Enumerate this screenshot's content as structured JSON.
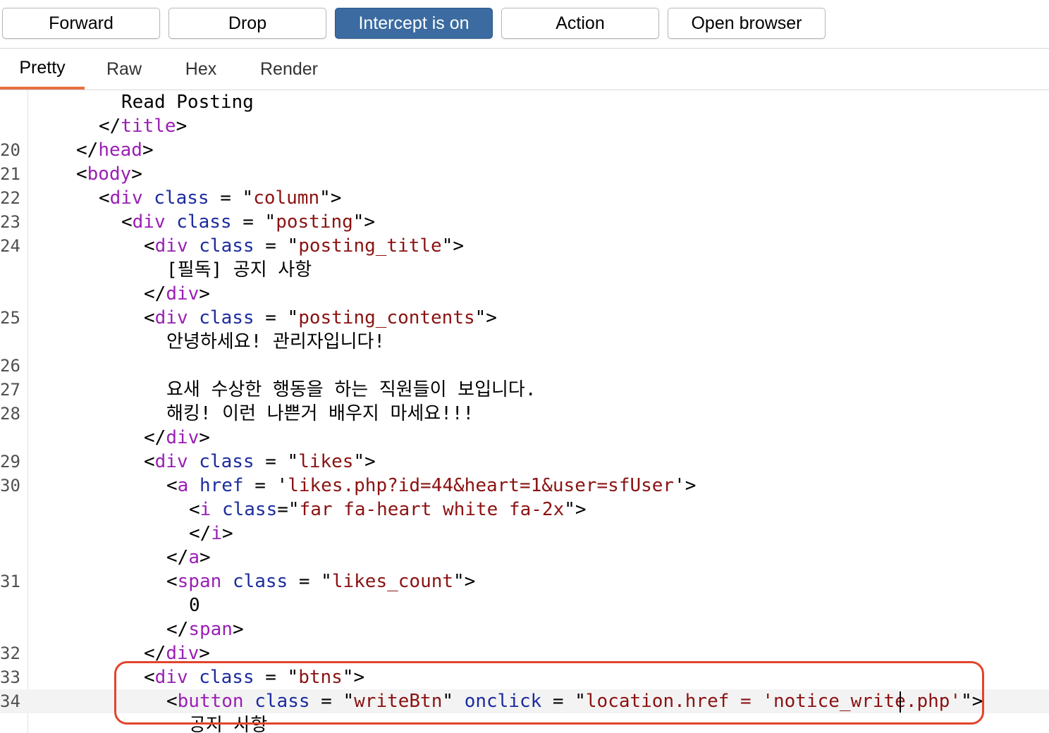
{
  "toolbar": {
    "forward_label": "Forward",
    "drop_label": "Drop",
    "intercept_label": "Intercept is on",
    "action_label": "Action",
    "open_browser_label": "Open browser"
  },
  "tabs": {
    "pretty": "Pretty",
    "raw": "Raw",
    "hex": "Hex",
    "render": "Render",
    "selected": "Pretty"
  },
  "colors": {
    "tag": "#9a1fb5",
    "attribute": "#1b2c9e",
    "string": "#8b1212",
    "accent_tab": "#e8703f",
    "intercept_button": "#3b6ba0",
    "highlight_box": "#e2442b"
  },
  "code": {
    "current_line": "34",
    "lines": [
      {
        "num": "",
        "indent": 4,
        "tokens": [
          {
            "t": "p",
            "s": "Read Posting"
          }
        ]
      },
      {
        "num": "",
        "indent": 3,
        "tokens": [
          {
            "t": "p",
            "s": "</"
          },
          {
            "t": "tag",
            "s": "title"
          },
          {
            "t": "p",
            "s": ">"
          }
        ]
      },
      {
        "num": "20",
        "indent": 2,
        "tokens": [
          {
            "t": "p",
            "s": "</"
          },
          {
            "t": "tag",
            "s": "head"
          },
          {
            "t": "p",
            "s": ">"
          }
        ]
      },
      {
        "num": "21",
        "indent": 2,
        "tokens": [
          {
            "t": "p",
            "s": "<"
          },
          {
            "t": "tag",
            "s": "body"
          },
          {
            "t": "p",
            "s": ">"
          }
        ]
      },
      {
        "num": "22",
        "indent": 3,
        "tokens": [
          {
            "t": "p",
            "s": "<"
          },
          {
            "t": "tag",
            "s": "div"
          },
          {
            "t": "p",
            "s": " "
          },
          {
            "t": "attr",
            "s": "class"
          },
          {
            "t": "p",
            "s": " = \""
          },
          {
            "t": "str",
            "s": "column"
          },
          {
            "t": "p",
            "s": "\">"
          }
        ]
      },
      {
        "num": "23",
        "indent": 4,
        "tokens": [
          {
            "t": "p",
            "s": "<"
          },
          {
            "t": "tag",
            "s": "div"
          },
          {
            "t": "p",
            "s": " "
          },
          {
            "t": "attr",
            "s": "class"
          },
          {
            "t": "p",
            "s": " = \""
          },
          {
            "t": "str",
            "s": "posting"
          },
          {
            "t": "p",
            "s": "\">"
          }
        ]
      },
      {
        "num": "24",
        "indent": 5,
        "tokens": [
          {
            "t": "p",
            "s": "<"
          },
          {
            "t": "tag",
            "s": "div"
          },
          {
            "t": "p",
            "s": " "
          },
          {
            "t": "attr",
            "s": "class"
          },
          {
            "t": "p",
            "s": " = \""
          },
          {
            "t": "str",
            "s": "posting_title"
          },
          {
            "t": "p",
            "s": "\">"
          }
        ]
      },
      {
        "num": "",
        "indent": 6,
        "tokens": [
          {
            "t": "p",
            "s": "[필독] 공지 사항"
          }
        ]
      },
      {
        "num": "",
        "indent": 5,
        "tokens": [
          {
            "t": "p",
            "s": "</"
          },
          {
            "t": "tag",
            "s": "div"
          },
          {
            "t": "p",
            "s": ">"
          }
        ]
      },
      {
        "num": "25",
        "indent": 5,
        "tokens": [
          {
            "t": "p",
            "s": "<"
          },
          {
            "t": "tag",
            "s": "div"
          },
          {
            "t": "p",
            "s": " "
          },
          {
            "t": "attr",
            "s": "class"
          },
          {
            "t": "p",
            "s": " = \""
          },
          {
            "t": "str",
            "s": "posting_contents"
          },
          {
            "t": "p",
            "s": "\">"
          }
        ]
      },
      {
        "num": "",
        "indent": 6,
        "tokens": [
          {
            "t": "p",
            "s": "안녕하세요! 관리자입니다!"
          }
        ]
      },
      {
        "num": "26",
        "indent": 6,
        "tokens": []
      },
      {
        "num": "27",
        "indent": 6,
        "tokens": [
          {
            "t": "p",
            "s": "요새 수상한 행동을 하는 직원들이 보입니다."
          }
        ]
      },
      {
        "num": "28",
        "indent": 6,
        "tokens": [
          {
            "t": "p",
            "s": "해킹! 이런 나쁜거 배우지 마세요!!!"
          }
        ]
      },
      {
        "num": "",
        "indent": 5,
        "tokens": [
          {
            "t": "p",
            "s": "</"
          },
          {
            "t": "tag",
            "s": "div"
          },
          {
            "t": "p",
            "s": ">"
          }
        ]
      },
      {
        "num": "29",
        "indent": 5,
        "tokens": [
          {
            "t": "p",
            "s": "<"
          },
          {
            "t": "tag",
            "s": "div"
          },
          {
            "t": "p",
            "s": " "
          },
          {
            "t": "attr",
            "s": "class"
          },
          {
            "t": "p",
            "s": " = \""
          },
          {
            "t": "str",
            "s": "likes"
          },
          {
            "t": "p",
            "s": "\">"
          }
        ]
      },
      {
        "num": "30",
        "indent": 6,
        "tokens": [
          {
            "t": "p",
            "s": "<"
          },
          {
            "t": "tag",
            "s": "a"
          },
          {
            "t": "p",
            "s": " "
          },
          {
            "t": "attr",
            "s": "href"
          },
          {
            "t": "p",
            "s": " = '"
          },
          {
            "t": "str",
            "s": "likes.php?id=44&heart=1&user=sfUser"
          },
          {
            "t": "p",
            "s": "'>"
          }
        ]
      },
      {
        "num": "",
        "indent": 7,
        "tokens": [
          {
            "t": "p",
            "s": "<"
          },
          {
            "t": "tag",
            "s": "i"
          },
          {
            "t": "p",
            "s": " "
          },
          {
            "t": "attr",
            "s": "class"
          },
          {
            "t": "p",
            "s": "=\""
          },
          {
            "t": "str",
            "s": "far fa-heart white fa-2x"
          },
          {
            "t": "p",
            "s": "\">"
          }
        ]
      },
      {
        "num": "",
        "indent": 7,
        "tokens": [
          {
            "t": "p",
            "s": "</"
          },
          {
            "t": "tag",
            "s": "i"
          },
          {
            "t": "p",
            "s": ">"
          }
        ]
      },
      {
        "num": "",
        "indent": 6,
        "tokens": [
          {
            "t": "p",
            "s": "</"
          },
          {
            "t": "tag",
            "s": "a"
          },
          {
            "t": "p",
            "s": ">"
          }
        ]
      },
      {
        "num": "31",
        "indent": 6,
        "tokens": [
          {
            "t": "p",
            "s": "<"
          },
          {
            "t": "tag",
            "s": "span"
          },
          {
            "t": "p",
            "s": " "
          },
          {
            "t": "attr",
            "s": "class"
          },
          {
            "t": "p",
            "s": " = \""
          },
          {
            "t": "str",
            "s": "likes_count"
          },
          {
            "t": "p",
            "s": "\">"
          }
        ]
      },
      {
        "num": "",
        "indent": 7,
        "tokens": [
          {
            "t": "p",
            "s": "0"
          }
        ]
      },
      {
        "num": "",
        "indent": 6,
        "tokens": [
          {
            "t": "p",
            "s": "</"
          },
          {
            "t": "tag",
            "s": "span"
          },
          {
            "t": "p",
            "s": ">"
          }
        ]
      },
      {
        "num": "32",
        "indent": 5,
        "tokens": [
          {
            "t": "p",
            "s": "</"
          },
          {
            "t": "tag",
            "s": "div"
          },
          {
            "t": "p",
            "s": ">"
          }
        ]
      },
      {
        "num": "33",
        "indent": 5,
        "tokens": [
          {
            "t": "p",
            "s": "<"
          },
          {
            "t": "tag",
            "s": "div"
          },
          {
            "t": "p",
            "s": " "
          },
          {
            "t": "attr",
            "s": "class"
          },
          {
            "t": "p",
            "s": " = \""
          },
          {
            "t": "str",
            "s": "btns"
          },
          {
            "t": "p",
            "s": "\">"
          }
        ]
      },
      {
        "num": "34",
        "indent": 6,
        "tokens": [
          {
            "t": "p",
            "s": "<"
          },
          {
            "t": "tag",
            "s": "button"
          },
          {
            "t": "p",
            "s": " "
          },
          {
            "t": "attr",
            "s": "class"
          },
          {
            "t": "p",
            "s": " = \""
          },
          {
            "t": "str",
            "s": "writeBtn"
          },
          {
            "t": "p",
            "s": "\" "
          },
          {
            "t": "attr",
            "s": "onclick"
          },
          {
            "t": "p",
            "s": " = \""
          },
          {
            "t": "str",
            "s": "location.href = 'notice_write.php'"
          },
          {
            "t": "p",
            "s": "\">"
          }
        ]
      },
      {
        "num": "",
        "indent": 7,
        "tokens": [
          {
            "t": "p",
            "s": "공지 사항"
          }
        ]
      }
    ]
  }
}
